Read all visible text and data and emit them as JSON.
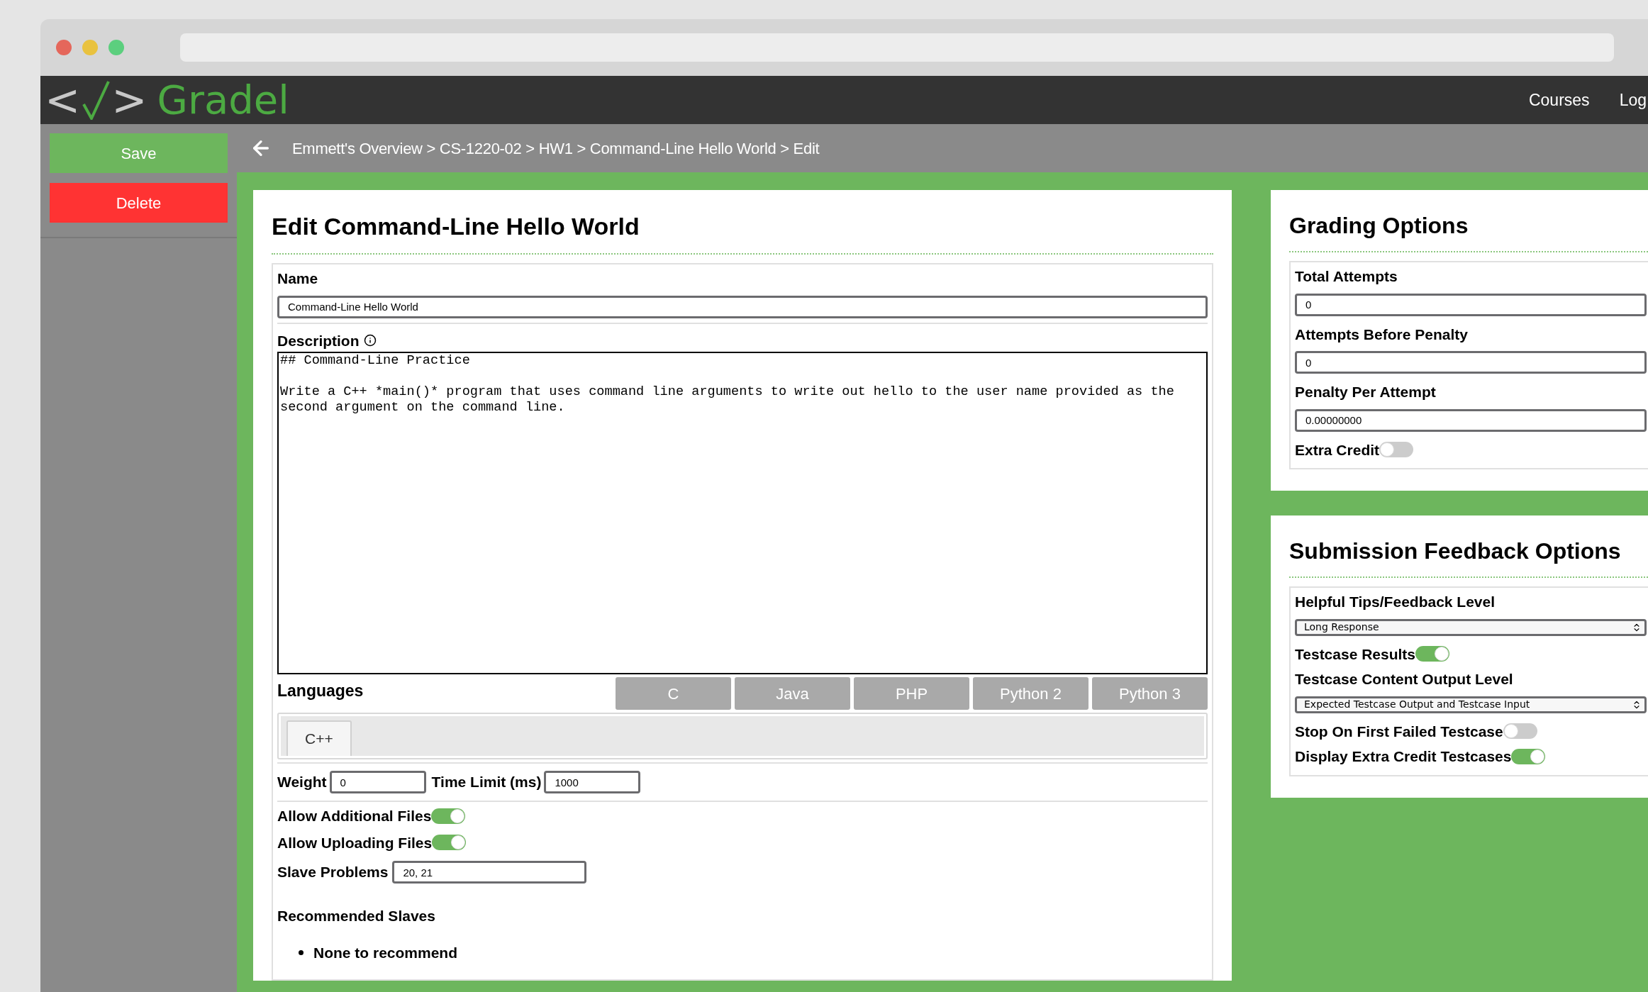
{
  "header": {
    "logo": {
      "open": "<",
      "close": ">",
      "name": "Gradel"
    },
    "nav": [
      "Courses",
      "Log"
    ]
  },
  "sidebar": {
    "buttons": [
      {
        "label": "Save",
        "kind": "save"
      },
      {
        "label": "Delete",
        "kind": "delete"
      }
    ]
  },
  "breadcrumb": "Emmett's Overview > CS-1220-02 > HW1 > Command-Line Hello World > Edit",
  "edit": {
    "title": "Edit Command-Line Hello World",
    "name": {
      "label": "Name",
      "value": "Command-Line Hello World"
    },
    "description": {
      "label": "Description",
      "lines": [
        "## Command-Line Practice",
        "Write a C++ *main()* program that uses command line arguments to write out hello to the user name provided as the second argument on the command line."
      ]
    },
    "languages": {
      "label": "Languages",
      "options": [
        {
          "label": "C",
          "selected": false
        },
        {
          "label": "Java",
          "selected": false
        },
        {
          "label": "PHP",
          "selected": false
        },
        {
          "label": "Python 2",
          "selected": false
        },
        {
          "label": "Python 3",
          "selected": false
        },
        {
          "label": "C++",
          "selected": true
        }
      ]
    },
    "weight": {
      "label": "Weight",
      "value": "0"
    },
    "time_limit": {
      "label": "Time Limit (ms)",
      "value": "1000"
    },
    "toggles": [
      {
        "label": "Allow Additional Files",
        "on": true
      },
      {
        "label": "Allow Uploading Files",
        "on": true
      }
    ],
    "slave_problems": {
      "label": "Slave Problems",
      "value": "20, 21"
    },
    "recommended": {
      "label": "Recommended Slaves",
      "items": [
        "None to recommend"
      ]
    }
  },
  "grading": {
    "title": "Grading Options",
    "fields": [
      {
        "kind": "input",
        "label": "Total Attempts",
        "value": "0"
      },
      {
        "kind": "input",
        "label": "Attempts Before Penalty",
        "value": "0"
      },
      {
        "kind": "input",
        "label": "Penalty Per Attempt",
        "value": "0.00000000"
      },
      {
        "kind": "toggle",
        "label": "Extra Credit",
        "on": false
      }
    ]
  },
  "feedback": {
    "title": "Submission Feedback Options",
    "fields": [
      {
        "kind": "select",
        "label": "Helpful Tips/Feedback Level",
        "value": "Long Response"
      },
      {
        "kind": "toggle",
        "label": "Testcase Results",
        "on": true
      },
      {
        "kind": "select",
        "label": "Testcase Content Output Level",
        "value": "Expected Testcase Output and Testcase Input"
      },
      {
        "kind": "toggle",
        "label": "Stop On First Failed Testcase",
        "on": false
      },
      {
        "kind": "toggle",
        "label": "Display Extra Credit Testcases",
        "on": true
      }
    ]
  }
}
